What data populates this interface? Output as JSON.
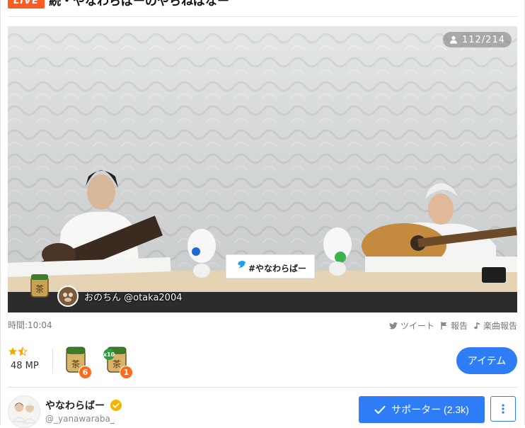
{
  "stream": {
    "live_label": "LIVE",
    "title": "続・やなわらばーのやらねばなー"
  },
  "video": {
    "viewers": "112/214",
    "caption": "おのちん @otaka2004",
    "banner_text": "#やなわらばー"
  },
  "meta": {
    "time": "時間:10:04",
    "tweet_label": "ツイート",
    "report_label": "報告",
    "music_report_label": "楽曲報告"
  },
  "items": {
    "mp": "48 MP",
    "tea_count": "6",
    "tea10_count": "1",
    "tea10_multiplier": "x10",
    "tea_glyph": "茶",
    "item_button": "アイテム"
  },
  "channel": {
    "name": "やなわらばー",
    "handle": "@_yanawaraba_",
    "supporter_label": "サポーター (2.3k)"
  },
  "colors": {
    "live": "#ff5a1f",
    "accent": "#2f7df6",
    "badge": "#ff6a1a",
    "verified": "#f5b400"
  }
}
